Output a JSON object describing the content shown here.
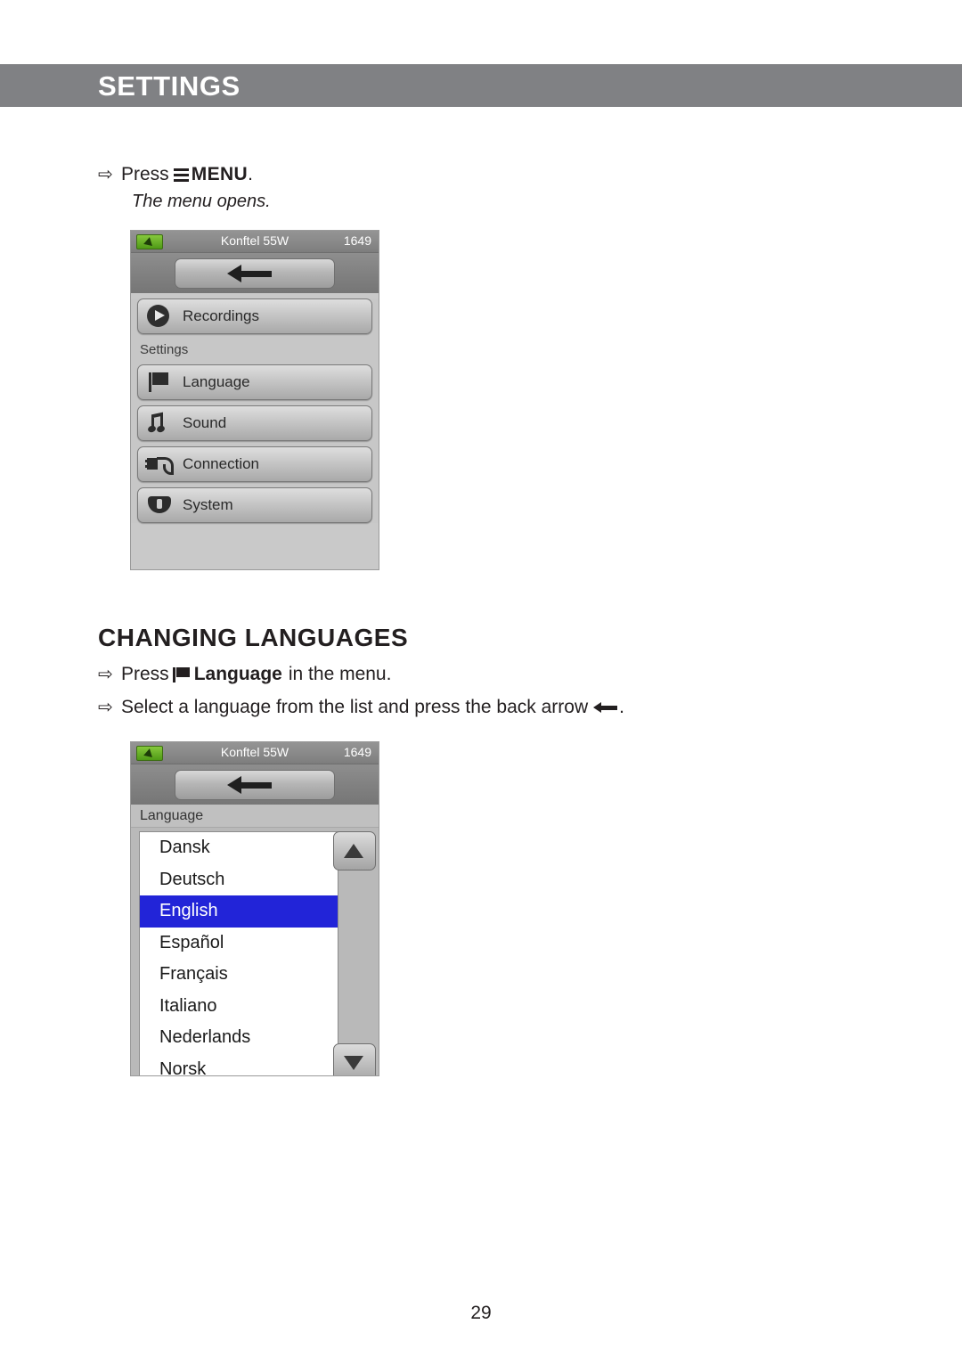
{
  "header": {
    "title": "SETTINGS"
  },
  "steps": {
    "press_prefix": "Press",
    "menu_label": "MENU",
    "menu_period": ".",
    "note": "The menu opens."
  },
  "section": {
    "title": "CHANGING LANGUAGES",
    "step1_prefix": "Press",
    "step1_bold": "Language",
    "step1_suffix": "in the menu.",
    "step2_prefix": "Select a language from the list and press the back arrow",
    "step2_suffix": "."
  },
  "device_menu": {
    "status": {
      "title": "Konftel 55W",
      "clock": "1649",
      "battery_icon": "battery-charging-icon"
    },
    "back_button": "back-arrow-icon",
    "rows": [
      {
        "label": "Recordings",
        "icon": "play-icon"
      }
    ],
    "group_label": "Settings",
    "settings_rows": [
      {
        "label": "Language",
        "icon": "flag-icon"
      },
      {
        "label": "Sound",
        "icon": "music-note-icon"
      },
      {
        "label": "Connection",
        "icon": "connection-plug-icon"
      },
      {
        "label": "System",
        "icon": "system-cone-icon"
      }
    ]
  },
  "device_language": {
    "status": {
      "title": "Konftel 55W",
      "clock": "1649",
      "battery_icon": "battery-charging-icon"
    },
    "back_button": "back-arrow-icon",
    "list_title": "Language",
    "items": [
      {
        "label": "Dansk",
        "selected": false
      },
      {
        "label": "Deutsch",
        "selected": false
      },
      {
        "label": "English",
        "selected": true
      },
      {
        "label": "Español",
        "selected": false
      },
      {
        "label": "Français",
        "selected": false
      },
      {
        "label": "Italiano",
        "selected": false
      },
      {
        "label": "Nederlands",
        "selected": false
      },
      {
        "label": "Norsk",
        "selected": false
      }
    ],
    "scroll_up_icon": "triangle-up-icon",
    "scroll_down_icon": "triangle-down-icon"
  },
  "footer": {
    "page_number": "29"
  }
}
